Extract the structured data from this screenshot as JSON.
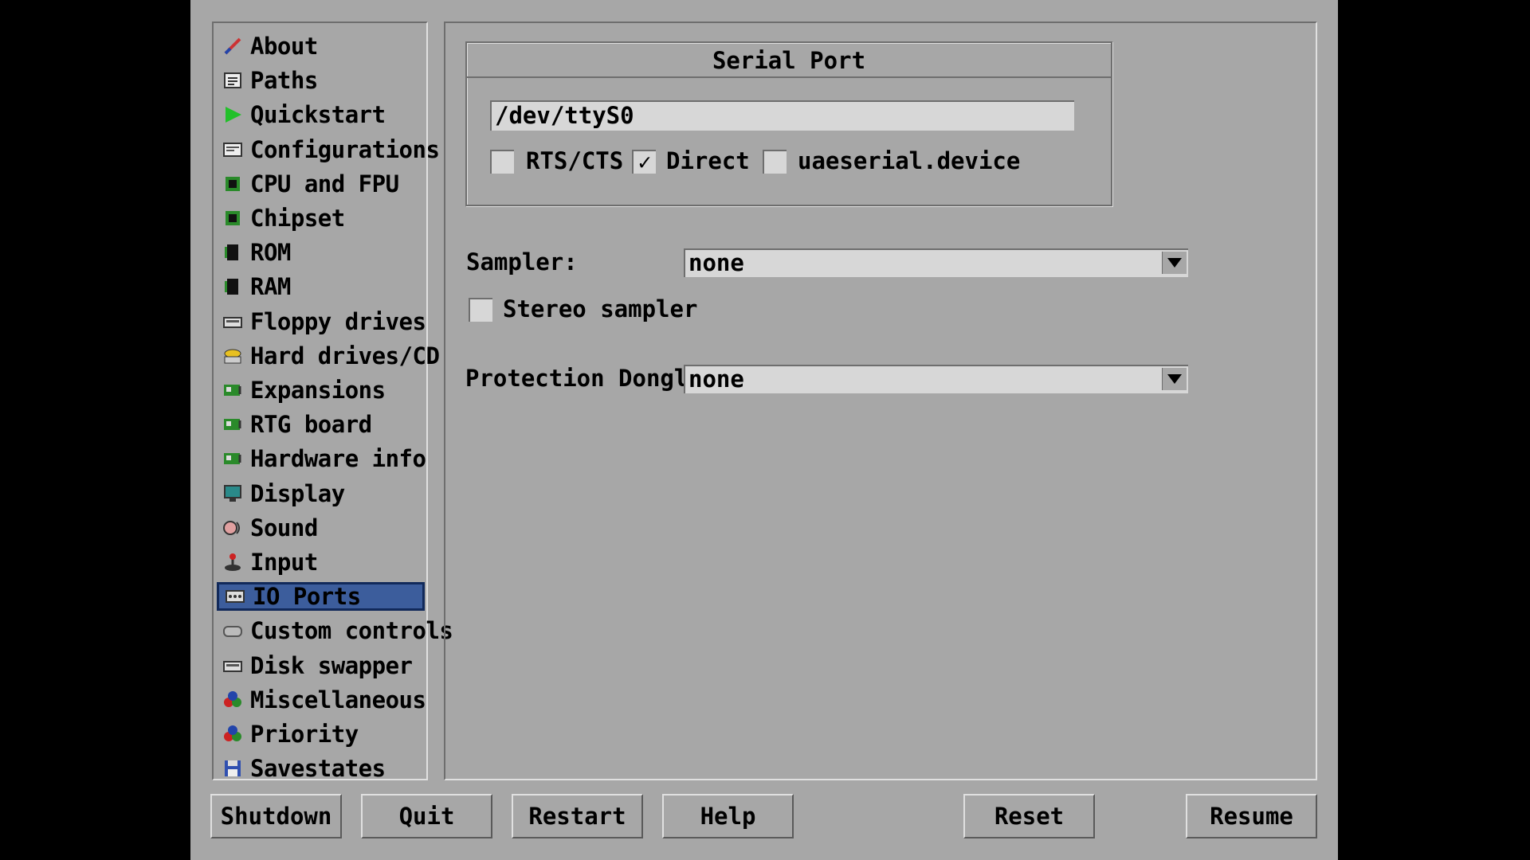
{
  "sidebar": {
    "items": [
      {
        "label": "About",
        "icon": "about-icon"
      },
      {
        "label": "Paths",
        "icon": "paths-icon"
      },
      {
        "label": "Quickstart",
        "icon": "quickstart-icon"
      },
      {
        "label": "Configurations",
        "icon": "configurations-icon"
      },
      {
        "label": "CPU and FPU",
        "icon": "cpu-icon"
      },
      {
        "label": "Chipset",
        "icon": "chipset-icon"
      },
      {
        "label": "ROM",
        "icon": "rom-icon"
      },
      {
        "label": "RAM",
        "icon": "ram-icon"
      },
      {
        "label": "Floppy drives",
        "icon": "floppy-icon"
      },
      {
        "label": "Hard drives/CD",
        "icon": "harddrive-icon"
      },
      {
        "label": "Expansions",
        "icon": "expansion-card-icon"
      },
      {
        "label": "RTG board",
        "icon": "expansion-card-icon"
      },
      {
        "label": "Hardware info",
        "icon": "expansion-card-icon"
      },
      {
        "label": "Display",
        "icon": "display-icon"
      },
      {
        "label": "Sound",
        "icon": "sound-icon"
      },
      {
        "label": "Input",
        "icon": "joystick-icon"
      },
      {
        "label": "IO Ports",
        "icon": "ioports-icon"
      },
      {
        "label": "Custom controls",
        "icon": "gamepad-icon"
      },
      {
        "label": "Disk swapper",
        "icon": "floppy-icon"
      },
      {
        "label": "Miscellaneous",
        "icon": "misc-icon"
      },
      {
        "label": "Priority",
        "icon": "misc-icon"
      },
      {
        "label": "Savestates",
        "icon": "save-icon"
      }
    ],
    "selected": "IO Ports",
    "selected_color": "#3c5d9c"
  },
  "serial_port": {
    "title": "Serial Port",
    "device": "/dev/ttyS0",
    "rts_cts_label": "RTS/CTS",
    "rts_cts_checked": false,
    "direct_label": "Direct",
    "direct_checked": true,
    "uaeserial_label": "uaeserial.device",
    "uaeserial_checked": false,
    "check_mark": "✓"
  },
  "sampler": {
    "label": "Sampler:",
    "value": "none",
    "stereo_label": "Stereo sampler",
    "stereo_checked": false
  },
  "dongle": {
    "label": "Protection Dongle:",
    "value": "none"
  },
  "buttons": {
    "shutdown": "Shutdown",
    "quit": "Quit",
    "restart": "Restart",
    "help": "Help",
    "reset": "Reset",
    "resume": "Resume"
  }
}
